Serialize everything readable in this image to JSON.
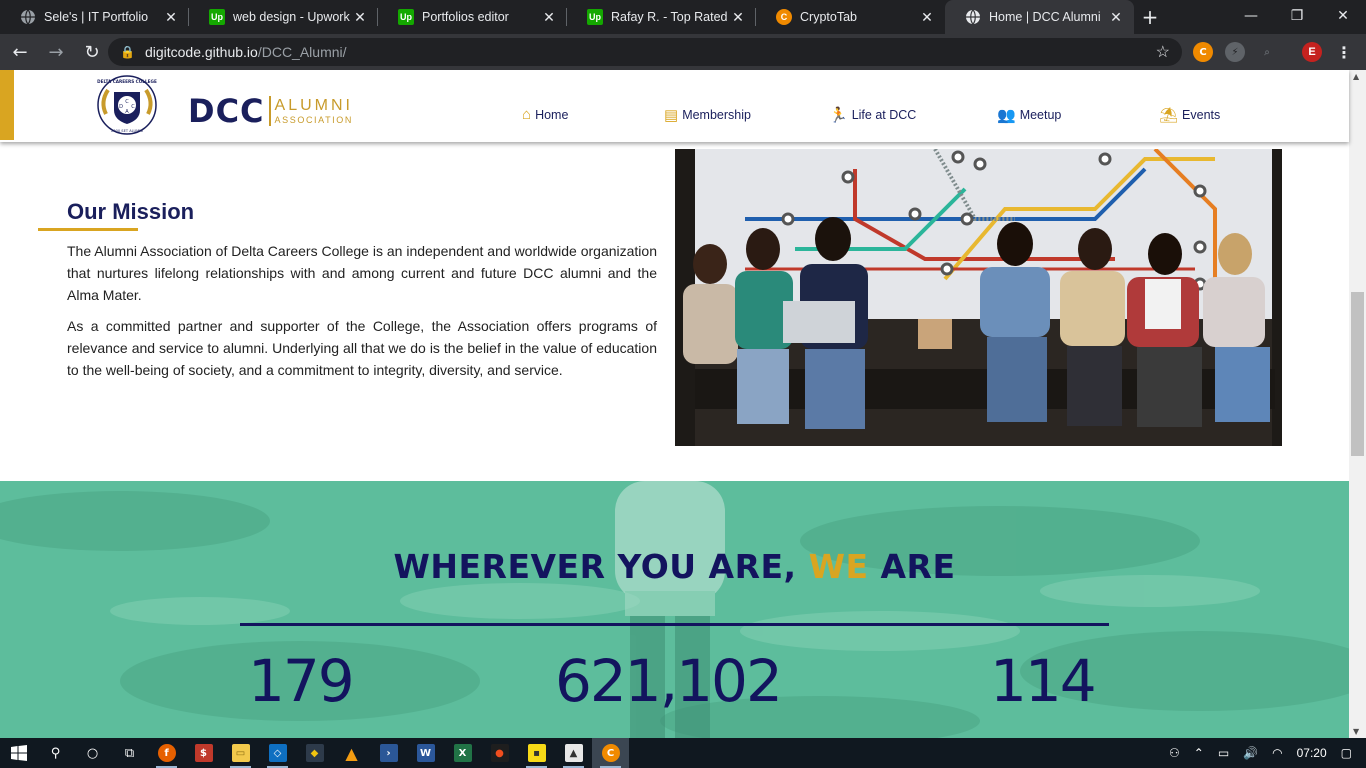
{
  "browser": {
    "tabs": [
      {
        "title": "Sele's | IT Portfolio",
        "favicon": "globe-icon",
        "active": false
      },
      {
        "title": "web design - Upwork",
        "favicon": "upwork-icon",
        "active": false
      },
      {
        "title": "Portfolios editor",
        "favicon": "upwork-icon",
        "active": false
      },
      {
        "title": "Rafay R. - Top Rated | D",
        "favicon": "upwork-icon",
        "active": false
      },
      {
        "title": "CryptoTab",
        "favicon": "cryptotab-icon",
        "active": false
      },
      {
        "title": "Home | DCC Alumni",
        "favicon": "globe-icon",
        "active": true
      }
    ],
    "url_host": "digitcode.github.io",
    "url_path": "/DCC_Alumni/",
    "profile_initial": "E"
  },
  "site": {
    "logo": {
      "dcc": "DCC",
      "alumni": "ALUMNI",
      "association": "ASSOCIATION"
    },
    "crest": {
      "top": "DELTA CAREERS COLLEGE",
      "bottom": "2000 SET ALUMNI",
      "letters": [
        "D",
        "C",
        "C",
        "A"
      ]
    },
    "nav": [
      {
        "label": "Home",
        "icon": "home-icon"
      },
      {
        "label": "Membership",
        "icon": "id-card-icon"
      },
      {
        "label": "Life at DCC",
        "icon": "running-icon"
      },
      {
        "label": "Meetup",
        "icon": "people-icon"
      },
      {
        "label": "Events",
        "icon": "umbrella-beach-icon"
      }
    ],
    "mission": {
      "title": "Our Mission",
      "paragraphs": [
        "The Alumni Association of Delta Careers College is an independent and worldwide organization that nurtures lifelong relationships with and among current and future DCC alumni and the Alma Mater.",
        "As a committed partner and supporter of the College, the Association offers programs of relevance and service to alumni. Underlying all that we do is the belief in the value of education to the well-being of society, and a commitment to integrity, diversity, and service."
      ]
    },
    "band": {
      "title_pre": "WHEREVER YOU ARE, ",
      "title_highlight": "WE",
      "title_post": " ARE",
      "stats": [
        "179",
        "621,102",
        "114"
      ]
    }
  },
  "taskbar": {
    "time": "07:20",
    "apps": [
      "start-icon",
      "search-icon",
      "cortana-icon",
      "task-view-icon",
      "firefox-icon",
      "dollar-app-icon",
      "file-explorer-icon",
      "vscode-icon",
      "git-icon",
      "vlc-icon",
      "powershell-icon",
      "word-icon",
      "excel-icon",
      "figma-icon",
      "sticky-notes-icon",
      "photos-icon",
      "cryptotab-icon"
    ]
  },
  "colors": {
    "navy": "#1a1f5c",
    "gold": "#d9a521",
    "band": "#5dbd9c",
    "chrome_dark": "#202124"
  }
}
